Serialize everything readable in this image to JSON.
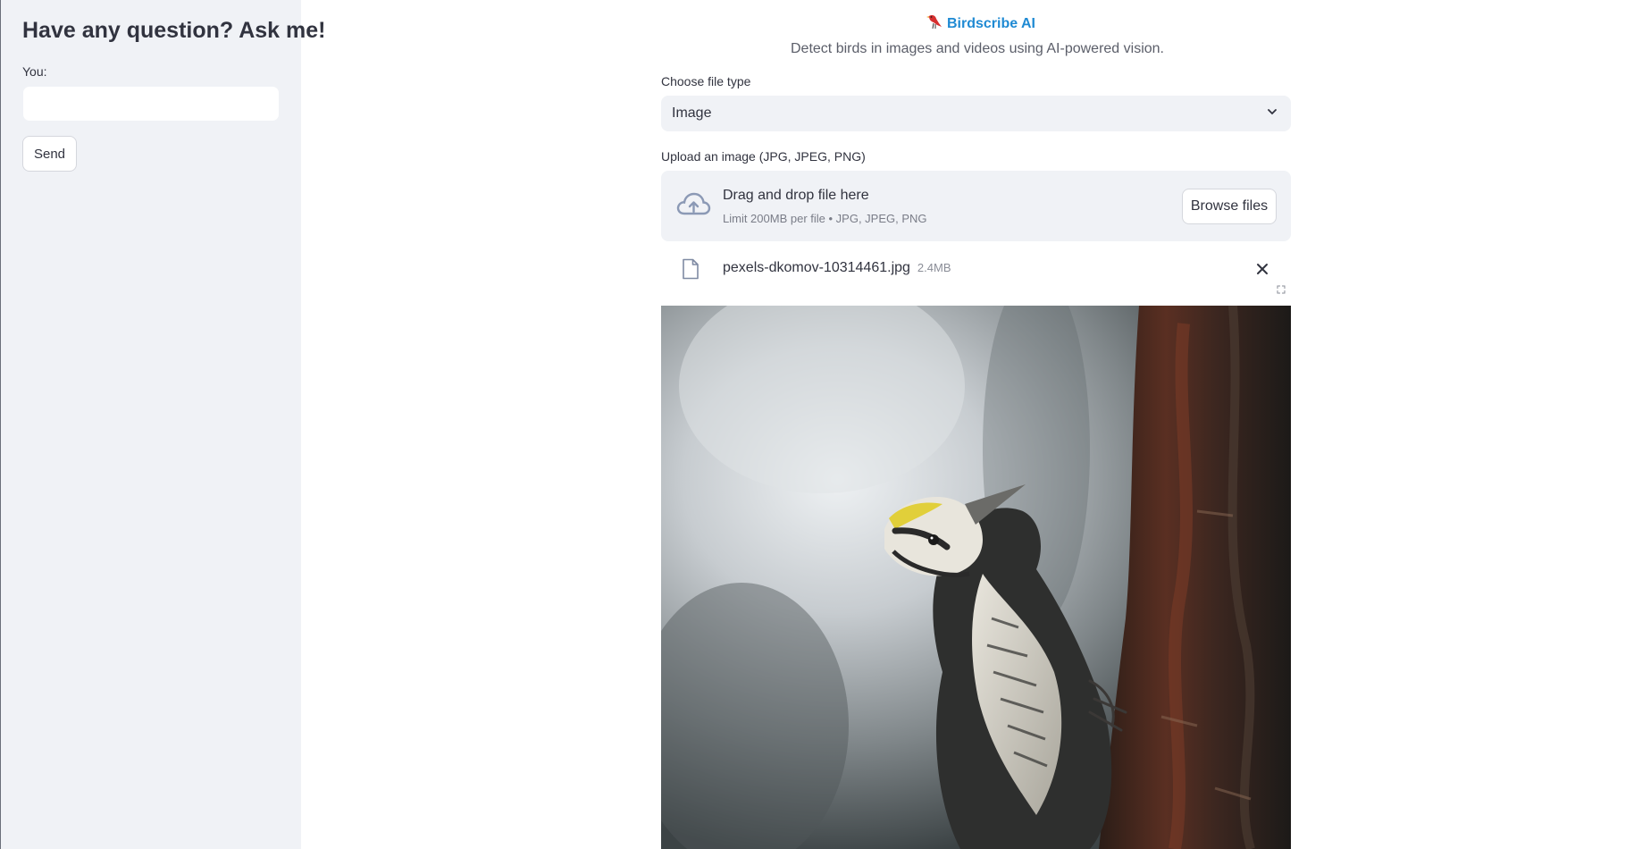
{
  "sidebar": {
    "title": "Have any question? Ask me!",
    "input_label": "You:",
    "input_value": "",
    "send_label": "Send"
  },
  "main": {
    "brand": "Birdscribe AI",
    "subtitle": "Detect birds in images and videos using AI-powered vision.",
    "file_type": {
      "label": "Choose file type",
      "selected": "Image"
    },
    "uploader": {
      "label": "Upload an image (JPG, JPEG, PNG)",
      "title": "Drag and drop file here",
      "limit": "Limit 200MB per file • JPG, JPEG, PNG",
      "browse_label": "Browse files"
    },
    "uploaded_file": {
      "name": "pexels-dkomov-10314461.jpg",
      "size": "2.4MB"
    }
  },
  "icons": {
    "brand": "bird-icon",
    "dropdown": "chevron-down-icon",
    "upload": "cloud-upload-icon",
    "file": "file-icon",
    "remove": "close-icon",
    "fullscreen": "expand-icon"
  },
  "colors": {
    "accent": "#1f8ad3",
    "sidebar_bg": "#f0f2f6",
    "text": "#31333f"
  }
}
